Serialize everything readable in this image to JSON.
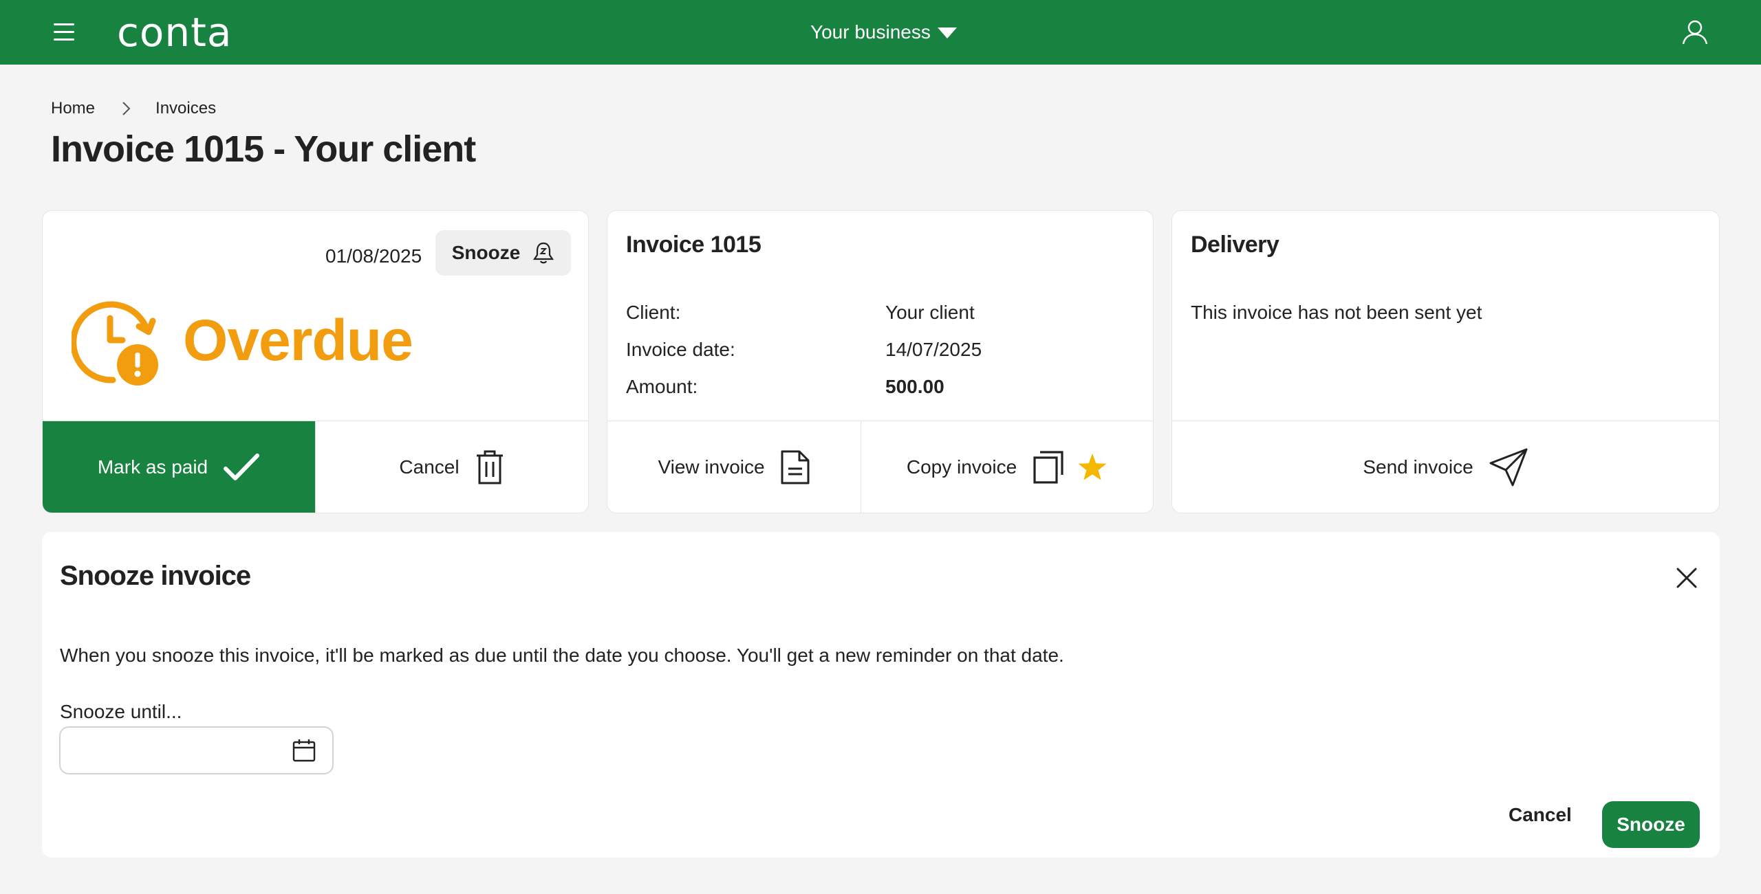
{
  "header": {
    "logo": "conta",
    "business_label": "Your business"
  },
  "breadcrumb": {
    "home": "Home",
    "current": "Invoices"
  },
  "page_title": "Invoice 1015 - Your client",
  "status_card": {
    "date": "01/08/2025",
    "snooze_label": "Snooze",
    "status": "Overdue",
    "mark_paid_label": "Mark as paid",
    "cancel_label": "Cancel"
  },
  "invoice_card": {
    "title": "Invoice 1015",
    "client_label": "Client:",
    "client_value": "Your client",
    "date_label": "Invoice date:",
    "date_value": "14/07/2025",
    "amount_label": "Amount:",
    "amount_value": "500.00",
    "view_label": "View invoice",
    "copy_label": "Copy invoice"
  },
  "delivery_card": {
    "title": "Delivery",
    "message": "This invoice has not been sent yet",
    "send_label": "Send invoice"
  },
  "snooze_panel": {
    "title": "Snooze invoice",
    "description": "When you snooze this invoice, it'll be marked as due until the date you choose. You'll get a new reminder on that date.",
    "field_label": "Snooze until...",
    "field_value": "",
    "cancel_label": "Cancel",
    "submit_label": "Snooze"
  },
  "colors": {
    "brand": "#188240",
    "overdue": "#f29c0f",
    "star": "#f5b800"
  },
  "icons": [
    "menu-icon",
    "chevron-down-icon",
    "user-icon",
    "chevron-right-icon",
    "bell-snooze-icon",
    "clock-alert-icon",
    "check-icon",
    "trash-icon",
    "document-icon",
    "copy-icon",
    "star-icon",
    "send-icon",
    "close-icon",
    "calendar-icon"
  ]
}
